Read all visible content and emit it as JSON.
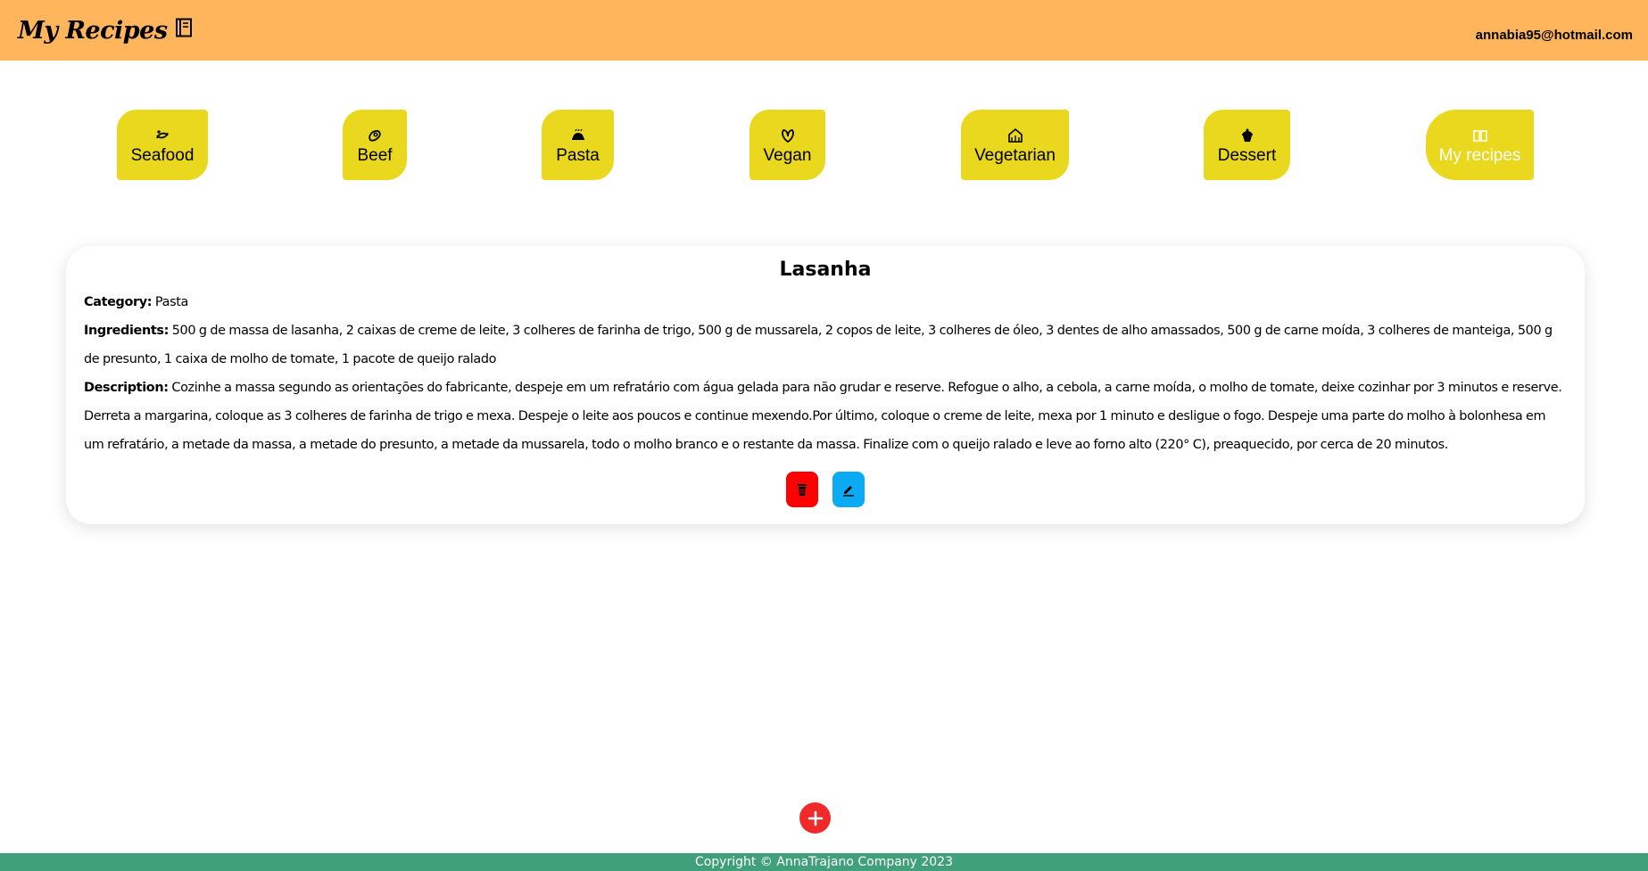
{
  "header": {
    "title": "My Recipes",
    "title_icon": "recipe-book-icon",
    "user_email": "annabia95@hotmail.com"
  },
  "categories": [
    {
      "label": "Seafood",
      "icon": "seafood-icon"
    },
    {
      "label": "Beef",
      "icon": "beef-icon"
    },
    {
      "label": "Pasta",
      "icon": "pasta-icon"
    },
    {
      "label": "Vegan",
      "icon": "vegan-icon"
    },
    {
      "label": "Vegetarian",
      "icon": "vegetarian-icon"
    },
    {
      "label": "Dessert",
      "icon": "dessert-icon"
    },
    {
      "label": "My recipes",
      "icon": "open-book-icon",
      "active": true
    }
  ],
  "recipe": {
    "title": "Lasanha",
    "category_label": "Category:",
    "category": "Pasta",
    "ingredients_label": "Ingredients:",
    "ingredients": "500 g de massa de lasanha, 2 caixas de creme de leite, 3 colheres de farinha de trigo, 500 g de mussarela, 2 copos de leite, 3 colheres de óleo, 3 dentes de alho amassados, 500 g de carne moída, 3 colheres de manteiga, 500 g de presunto, 1 caixa de molho de tomate, 1 pacote de queijo ralado",
    "description_label": "Description:",
    "description": "Cozinhe a massa segundo as orientações do fabricante, despeje em um refratário com água gelada para não grudar e reserve. Refogue o alho, a cebola, a carne moída, o molho de tomate, deixe cozinhar por 3 minutos e reserve. Derreta a margarina, coloque as 3 colheres de farinha de trigo e mexa. Despeje o leite aos poucos e continue mexendo.Por último, coloque o creme de leite, mexa por 1 minuto e desligue o fogo. Despeje uma parte do molho à bolonhesa em um refratário, a metade da massa, a metade do presunto, a metade da mussarela, todo o molho branco e o restante da massa. Finalize com o queijo ralado e leve ao forno alto (220° C), preaquecido, por cerca de 20 minutos."
  },
  "colors": {
    "header_bg": "#ffb55b",
    "category_bg": "#e9d81d",
    "delete_bg": "#ff0000",
    "edit_bg": "#0aaaf5",
    "add_bg": "#f02a2a",
    "footer_bg": "#3fa07a"
  },
  "footer": {
    "text": "Copyright © AnnaTrajano Company 2023"
  }
}
